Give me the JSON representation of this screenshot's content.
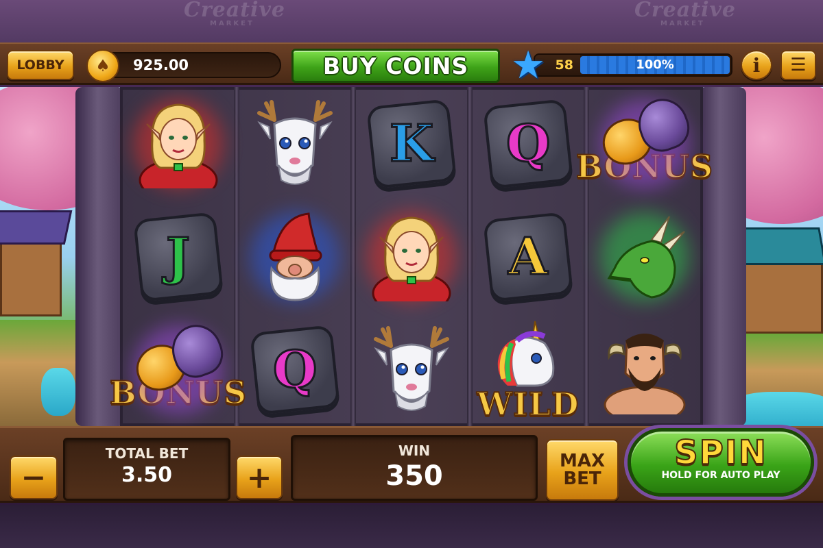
{
  "watermark": {
    "brand": "Creative",
    "sub": "MARKET"
  },
  "topbar": {
    "lobby_label": "LOBBY",
    "coin_balance": "925.00",
    "buy_coins_label": "BUY COINS",
    "level": "58",
    "xp_percent_label": "100%",
    "xp_fill_fraction": 1.0,
    "info_icon": "i",
    "menu_icon": "hamburger-menu-icon"
  },
  "reels": {
    "grid": [
      [
        "elf-girl",
        "bonus-acorn-stone-j-placeholder"
      ],
      []
    ],
    "columns": [
      [
        {
          "symbol": "elf-girl"
        },
        {
          "symbol": "J",
          "type": "letter",
          "color": "#2ec24a"
        },
        {
          "symbol": "bonus",
          "type": "bonus",
          "label": "BONUS"
        }
      ],
      [
        {
          "symbol": "white-deer"
        },
        {
          "symbol": "gnome"
        },
        {
          "symbol": "Q",
          "type": "letter",
          "color": "#e83ac8"
        }
      ],
      [
        {
          "symbol": "K",
          "type": "letter",
          "color": "#2a9ee8"
        },
        {
          "symbol": "elf-girl"
        },
        {
          "symbol": "white-deer"
        }
      ],
      [
        {
          "symbol": "Q",
          "type": "letter",
          "color": "#e83ac8"
        },
        {
          "symbol": "A",
          "type": "letter",
          "color": "#f6c83a"
        },
        {
          "symbol": "wild-unicorn",
          "type": "wild",
          "label": "WILD"
        }
      ],
      [
        {
          "symbol": "bonus",
          "type": "bonus",
          "label": "BONUS"
        },
        {
          "symbol": "green-dragon"
        },
        {
          "symbol": "minotaur"
        }
      ]
    ]
  },
  "bottombar": {
    "minus_label": "−",
    "total_bet_label": "TOTAL BET",
    "total_bet_value": "3.50",
    "plus_label": "+",
    "win_label": "WIN",
    "win_value": "350",
    "max_bet_line1": "MAX",
    "max_bet_line2": "BET",
    "spin_label": "SPIN",
    "spin_sub": "HOLD FOR AUTO PLAY"
  },
  "colors": {
    "accent_gold": "#e8a21a",
    "button_green": "#3ea318",
    "xp_blue": "#2a7ae0",
    "frame_brown": "#6b4026"
  }
}
